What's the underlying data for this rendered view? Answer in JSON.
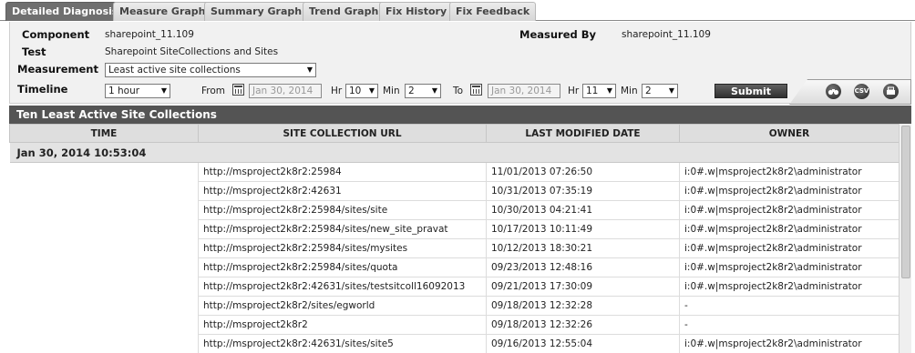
{
  "tabs": [
    "Detailed Diagnosis",
    "Measure Graph",
    "Summary Graph",
    "Trend Graph",
    "Fix History",
    "Fix Feedback"
  ],
  "form": {
    "component_label": "Component",
    "component_value": "sharepoint_11.109",
    "measured_by_label": "Measured By",
    "measured_by_value": "sharepoint_11.109",
    "test_label": "Test",
    "test_value": "Sharepoint SiteCollections and Sites",
    "measurement_label": "Measurement",
    "measurement_value": "Least active site collections",
    "timeline_label": "Timeline",
    "timeline_value": "1 hour",
    "from_label": "From",
    "from_date": "Jan 30, 2014",
    "from_hr_label": "Hr",
    "from_hr": "10",
    "from_min_label": "Min",
    "from_min": "2",
    "to_label": "To",
    "to_date": "Jan 30, 2014",
    "to_hr_label": "Hr",
    "to_hr": "11",
    "to_min_label": "Min",
    "to_min": "2",
    "submit_label": "Submit",
    "tool_icons": [
      "binoculars-icon",
      "csv-icon",
      "print-icon"
    ],
    "csv_text": "CSV"
  },
  "results": {
    "title": "Ten Least Active Site Collections",
    "columns": [
      "TIME",
      "SITE COLLECTION URL",
      "LAST MODIFIED DATE",
      "OWNER"
    ],
    "group_time": "Jan 30, 2014 10:53:04",
    "rows": [
      {
        "url": "http://msproject2k8r2:25984",
        "date": "11/01/2013 07:26:50",
        "owner": "i:0#.w|msproject2k8r2\\administrator"
      },
      {
        "url": "http://msproject2k8r2:42631",
        "date": "10/31/2013 07:35:19",
        "owner": "i:0#.w|msproject2k8r2\\administrator"
      },
      {
        "url": "http://msproject2k8r2:25984/sites/site",
        "date": "10/30/2013 04:21:41",
        "owner": "i:0#.w|msproject2k8r2\\administrator"
      },
      {
        "url": "http://msproject2k8r2:25984/sites/new_site_pravat",
        "date": "10/17/2013 10:11:49",
        "owner": "i:0#.w|msproject2k8r2\\administrator"
      },
      {
        "url": "http://msproject2k8r2:25984/sites/mysites",
        "date": "10/12/2013 18:30:21",
        "owner": "i:0#.w|msproject2k8r2\\administrator"
      },
      {
        "url": "http://msproject2k8r2:25984/sites/quota",
        "date": "09/23/2013 12:48:16",
        "owner": "i:0#.w|msproject2k8r2\\administrator"
      },
      {
        "url": "http://msproject2k8r2:42631/sites/testsitcoll16092013",
        "date": "09/21/2013 17:30:09",
        "owner": "i:0#.w|msproject2k8r2\\administrator"
      },
      {
        "url": "http://msproject2k8r2/sites/egworld",
        "date": "09/18/2013 12:32:28",
        "owner": "-"
      },
      {
        "url": "http://msproject2k8r2",
        "date": "09/18/2013 12:32:26",
        "owner": "-"
      },
      {
        "url": "http://msproject2k8r2:42631/sites/site5",
        "date": "09/16/2013 12:55:04",
        "owner": "i:0#.w|msproject2k8r2\\administrator"
      }
    ]
  }
}
